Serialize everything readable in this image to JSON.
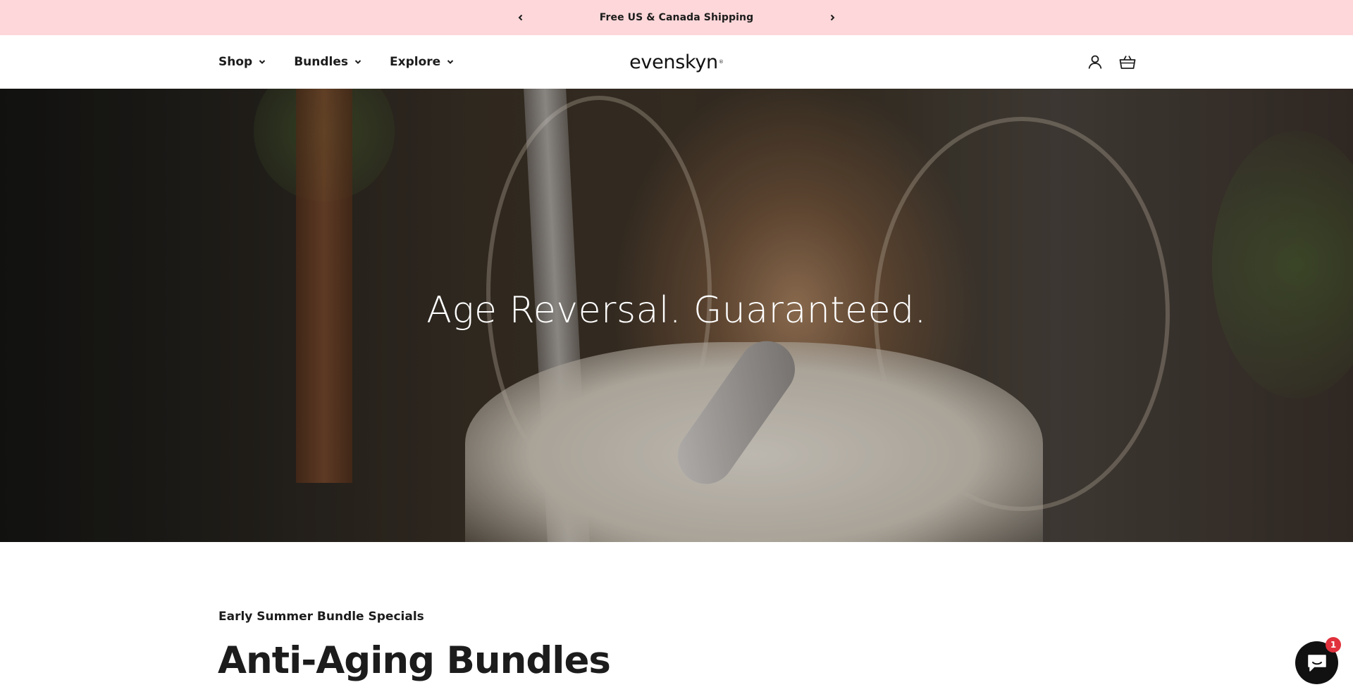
{
  "announcement": {
    "message": "Free US & Canada Shipping",
    "prev_icon": "chevron-left-icon",
    "next_icon": "chevron-right-icon",
    "background": "#fdd7d9"
  },
  "header": {
    "nav": [
      {
        "label": "Shop",
        "icon": "chevron-down-icon"
      },
      {
        "label": "Bundles",
        "icon": "chevron-down-icon"
      },
      {
        "label": "Explore",
        "icon": "chevron-down-icon"
      }
    ],
    "logo": {
      "text": "evenskyn",
      "mark": "®"
    },
    "account_icon": "account-icon",
    "cart_icon": "cart-basket-icon"
  },
  "hero": {
    "headline": "Age Reversal. Guaranteed."
  },
  "collection": {
    "eyebrow": "Early Summer Bundle Specials",
    "title": "Anti-Aging Bundles"
  },
  "chat": {
    "icon": "chat-icon",
    "badge_count": "1",
    "badge_color": "#e0313c"
  }
}
